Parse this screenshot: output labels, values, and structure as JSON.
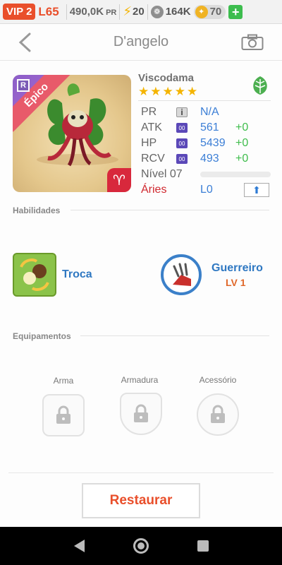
{
  "status": {
    "vip": "VIP 2",
    "level": "L65",
    "power": "490,0K",
    "power_unit": "PR",
    "energy": "20",
    "food": "164K",
    "coins": "70",
    "add": "+"
  },
  "header": {
    "title": "D'angelo"
  },
  "monster": {
    "rarity": "Épico",
    "rank_icon": "R",
    "species": "Viscodama",
    "stars": 5,
    "element": "leaf",
    "zodiac_symbol": "♈",
    "stats": {
      "pr_label": "PR",
      "pr_badge": "i",
      "pr_value": "N/A",
      "atk_label": "ATK",
      "atk_badge": "00",
      "atk_value": "561",
      "atk_bonus": "+0",
      "hp_label": "HP",
      "hp_badge": "00",
      "hp_value": "5439",
      "hp_bonus": "+0",
      "rcv_label": "RCV",
      "rcv_badge": "00",
      "rcv_value": "493",
      "rcv_bonus": "+0",
      "level_label": "Nível 07",
      "level_progress": 0,
      "sign_label": "Áries",
      "sign_level": "L0"
    }
  },
  "skills": {
    "section_title": "Habilidades",
    "skill_name": "Troca",
    "class_name": "Guerreiro",
    "class_level": "LV 1"
  },
  "equipment": {
    "section_title": "Equipamentos",
    "weapon": "Arma",
    "armor": "Armadura",
    "accessory": "Acessório"
  },
  "actions": {
    "restore": "Restaurar"
  },
  "colors": {
    "accent": "#e94f2b",
    "link_blue": "#3c7fd6",
    "bonus_green": "#3fbd4c",
    "star": "#f4b400"
  }
}
